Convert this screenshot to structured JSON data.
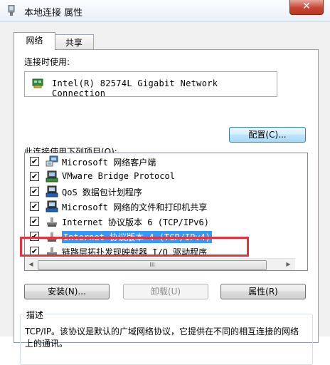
{
  "window": {
    "title": "本地连接 属性",
    "close_glyph": "✕"
  },
  "tabs": [
    {
      "label": "网络"
    },
    {
      "label": "共享"
    }
  ],
  "connect_using": {
    "label": "连接时使用:",
    "adapter_name": "Intel(R) 82574L Gigabit Network Connection",
    "configure_button": "配置(C)..."
  },
  "items_label": "此连接使用下列项目(O):",
  "items": [
    {
      "label": "Microsoft 网络客户端",
      "checked": true,
      "icon": "network-client-icon"
    },
    {
      "label": "VMware Bridge Protocol",
      "checked": true,
      "icon": "network-protocol-icon"
    },
    {
      "label": "QoS 数据包计划程序",
      "checked": true,
      "icon": "network-service-icon"
    },
    {
      "label": "Microsoft 网络的文件和打印机共享",
      "checked": true,
      "icon": "network-service-icon"
    },
    {
      "label": "Internet 协议版本 6 (TCP/IPv6)",
      "checked": true,
      "icon": "network-protocol-icon"
    },
    {
      "label": "Internet 协议版本 4 (TCP/IPv4)",
      "checked": true,
      "icon": "network-protocol-icon",
      "selected": true
    },
    {
      "label": "链路层拓扑发现映射器 I/O 驱动程序",
      "checked": true,
      "icon": "network-protocol-icon"
    }
  ],
  "check_glyph": "✔",
  "scroll": {
    "up": "▲",
    "down": "▼",
    "left": "◀",
    "right": "▶",
    "grip": "III"
  },
  "buttons": {
    "install": "安装(N)...",
    "uninstall": "卸载(U)",
    "properties": "属性(R)"
  },
  "description": {
    "legend": "描述",
    "text": "TCP/IP。该协议是默认的广域网络协议，它提供在不同的相互连接的网络上的通讯。"
  },
  "colors": {
    "selection": "#3399ff",
    "highlight_box": "#e8323b"
  }
}
